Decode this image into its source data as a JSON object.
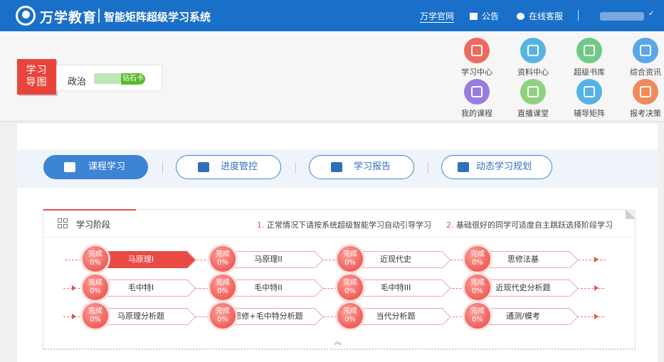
{
  "topbar": {
    "brand": "万学教育",
    "system_title": "智能矩阵超级学习系统",
    "nav": {
      "official": "万学官网",
      "notice": "公告",
      "service": "在线客服"
    },
    "user_caret": "✓"
  },
  "header": {
    "map_badge": [
      "学习",
      "导图"
    ],
    "subject": "政治",
    "card_label": "钻石卡",
    "quick_links": [
      {
        "label": "学习中心",
        "color": "#ee6a5e"
      },
      {
        "label": "资料中心",
        "color": "#56b4e4"
      },
      {
        "label": "超级书库",
        "color": "#6ecb86"
      },
      {
        "label": "综合资讯",
        "color": "#5aa6e8"
      },
      {
        "label": "我的课程",
        "color": "#9a7ce0"
      },
      {
        "label": "直播课堂",
        "color": "#8fd17e"
      },
      {
        "label": "辅导矩阵",
        "color": "#54b2e6"
      },
      {
        "label": "报考决策",
        "color": "#f08a5a"
      }
    ]
  },
  "tabs": [
    "课程学习",
    "进度管控",
    "学习报告",
    "动态学习规划"
  ],
  "stage": {
    "title": "学习阶段",
    "note1_num": "1.",
    "note1": "正常情况下请按系统超级智能学习自动引导学习",
    "note2_num": "2.",
    "note2": "基础很好的同学可适度自主跳跃选择阶段学习",
    "ball_line1": "完成",
    "ball_line2": "0%",
    "rows": [
      [
        "马原理I",
        "马原理II",
        "近现代史",
        "思修法基"
      ],
      [
        "毛中特I",
        "毛中特II",
        "毛中特III",
        "近现代史分析题"
      ],
      [
        "马原理分析题",
        "思修+毛中特分析题",
        "当代分析题",
        "通测/模考"
      ]
    ],
    "active_step": "马原理I",
    "collapse_icon": "︽"
  }
}
